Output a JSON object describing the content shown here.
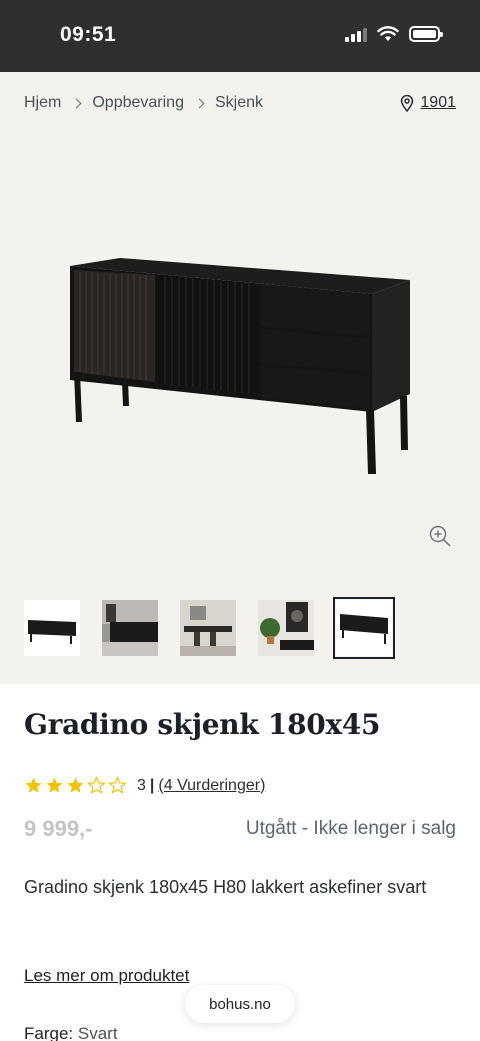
{
  "status_bar": {
    "time": "09:51"
  },
  "breadcrumb": {
    "items": [
      "Hjem",
      "Oppbevaring",
      "Skjenk"
    ]
  },
  "location": {
    "zip": "1901"
  },
  "product": {
    "title": "Gradino skjenk 180x45",
    "rating": {
      "stars": 3,
      "max_stars": 5,
      "value": "3",
      "separator": "|",
      "reviews_link": "(4 Vurderinger)"
    },
    "price": "9 999,-",
    "availability": "Utgått - Ikke lenger i salg",
    "description": "Gradino skjenk 180x45 H80 lakkert askefiner svart",
    "read_more": "Les mer om produktet",
    "color": {
      "label": "Farge:",
      "value": "Svart"
    }
  },
  "thumbnails": [
    "thumb-1",
    "thumb-2",
    "thumb-3",
    "thumb-4",
    "thumb-5"
  ],
  "active_thumbnail": 5,
  "browser": {
    "url": "bohus.no"
  },
  "colors": {
    "star": "#f2c300",
    "background": "#f4f2ef",
    "status_bar": "#2f2f31"
  }
}
